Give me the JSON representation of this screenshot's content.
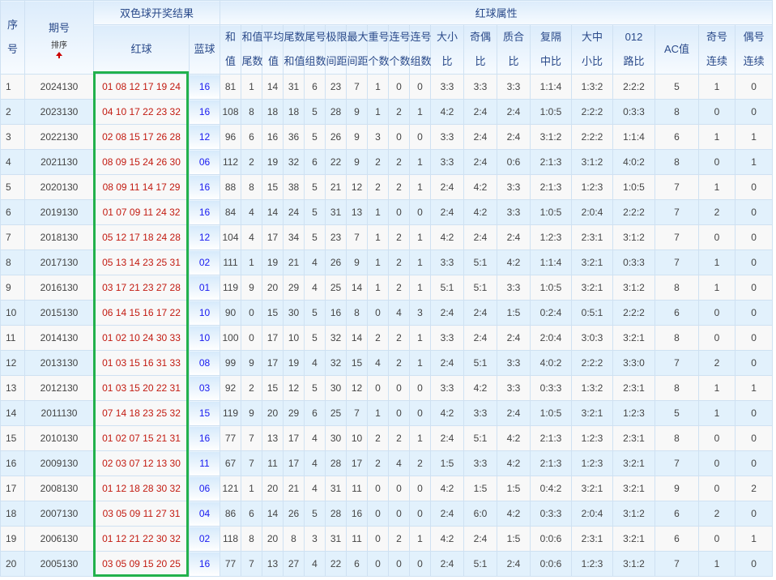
{
  "header": {
    "seq": "序号",
    "issue": "期号",
    "sort": "排序",
    "draw_result": "双色球开奖结果",
    "red_attrs": "红球属性",
    "red_ball": "红球",
    "blue_ball": "蓝球",
    "attrs": [
      "和值",
      "和值尾数",
      "平均值",
      "尾数和值",
      "尾号组数",
      "极限间距",
      "最大间距",
      "重号个数",
      "连号个数",
      "连号组数",
      "大小比",
      "奇偶比",
      "质合比",
      "复隔中比",
      "大中小比",
      "012路比",
      "AC值",
      "奇号连续",
      "偶号连续"
    ]
  },
  "colors": {
    "red_ball": "#c21a10",
    "blue_ball": "#1a1af0",
    "highlight_box": "#22b14c"
  },
  "rows": [
    {
      "seq": "1",
      "issue": "2024130",
      "red": "01 08 12 17 19 24",
      "blue": "16",
      "attrs": [
        "81",
        "1",
        "14",
        "31",
        "6",
        "23",
        "7",
        "1",
        "0",
        "0",
        "3:3",
        "3:3",
        "3:3",
        "1:1:4",
        "1:3:2",
        "2:2:2",
        "5",
        "1",
        "0"
      ]
    },
    {
      "seq": "2",
      "issue": "2023130",
      "red": "04 10 17 22 23 32",
      "blue": "16",
      "attrs": [
        "108",
        "8",
        "18",
        "18",
        "5",
        "28",
        "9",
        "1",
        "2",
        "1",
        "4:2",
        "2:4",
        "2:4",
        "1:0:5",
        "2:2:2",
        "0:3:3",
        "8",
        "0",
        "0"
      ]
    },
    {
      "seq": "3",
      "issue": "2022130",
      "red": "02 08 15 17 26 28",
      "blue": "12",
      "attrs": [
        "96",
        "6",
        "16",
        "36",
        "5",
        "26",
        "9",
        "3",
        "0",
        "0",
        "3:3",
        "2:4",
        "2:4",
        "3:1:2",
        "2:2:2",
        "1:1:4",
        "6",
        "1",
        "1"
      ]
    },
    {
      "seq": "4",
      "issue": "2021130",
      "red": "08 09 15 24 26 30",
      "blue": "06",
      "attrs": [
        "112",
        "2",
        "19",
        "32",
        "6",
        "22",
        "9",
        "2",
        "2",
        "1",
        "3:3",
        "2:4",
        "0:6",
        "2:1:3",
        "3:1:2",
        "4:0:2",
        "8",
        "0",
        "1"
      ]
    },
    {
      "seq": "5",
      "issue": "2020130",
      "red": "08 09 11 14 17 29",
      "blue": "16",
      "attrs": [
        "88",
        "8",
        "15",
        "38",
        "5",
        "21",
        "12",
        "2",
        "2",
        "1",
        "2:4",
        "4:2",
        "3:3",
        "2:1:3",
        "1:2:3",
        "1:0:5",
        "7",
        "1",
        "0"
      ]
    },
    {
      "seq": "6",
      "issue": "2019130",
      "red": "01 07 09 11 24 32",
      "blue": "16",
      "attrs": [
        "84",
        "4",
        "14",
        "24",
        "5",
        "31",
        "13",
        "1",
        "0",
        "0",
        "2:4",
        "4:2",
        "3:3",
        "1:0:5",
        "2:0:4",
        "2:2:2",
        "7",
        "2",
        "0"
      ]
    },
    {
      "seq": "7",
      "issue": "2018130",
      "red": "05 12 17 18 24 28",
      "blue": "12",
      "attrs": [
        "104",
        "4",
        "17",
        "34",
        "5",
        "23",
        "7",
        "1",
        "2",
        "1",
        "4:2",
        "2:4",
        "2:4",
        "1:2:3",
        "2:3:1",
        "3:1:2",
        "7",
        "0",
        "0"
      ]
    },
    {
      "seq": "8",
      "issue": "2017130",
      "red": "05 13 14 23 25 31",
      "blue": "02",
      "attrs": [
        "111",
        "1",
        "19",
        "21",
        "4",
        "26",
        "9",
        "1",
        "2",
        "1",
        "3:3",
        "5:1",
        "4:2",
        "1:1:4",
        "3:2:1",
        "0:3:3",
        "7",
        "1",
        "0"
      ]
    },
    {
      "seq": "9",
      "issue": "2016130",
      "red": "03 17 21 23 27 28",
      "blue": "01",
      "attrs": [
        "119",
        "9",
        "20",
        "29",
        "4",
        "25",
        "14",
        "1",
        "2",
        "1",
        "5:1",
        "5:1",
        "3:3",
        "1:0:5",
        "3:2:1",
        "3:1:2",
        "8",
        "1",
        "0"
      ]
    },
    {
      "seq": "10",
      "issue": "2015130",
      "red": "06 14 15 16 17 22",
      "blue": "10",
      "attrs": [
        "90",
        "0",
        "15",
        "30",
        "5",
        "16",
        "8",
        "0",
        "4",
        "3",
        "2:4",
        "2:4",
        "1:5",
        "0:2:4",
        "0:5:1",
        "2:2:2",
        "6",
        "0",
        "0"
      ]
    },
    {
      "seq": "11",
      "issue": "2014130",
      "red": "01 02 10 24 30 33",
      "blue": "10",
      "attrs": [
        "100",
        "0",
        "17",
        "10",
        "5",
        "32",
        "14",
        "2",
        "2",
        "1",
        "3:3",
        "2:4",
        "2:4",
        "2:0:4",
        "3:0:3",
        "3:2:1",
        "8",
        "0",
        "0"
      ]
    },
    {
      "seq": "12",
      "issue": "2013130",
      "red": "01 03 15 16 31 33",
      "blue": "08",
      "attrs": [
        "99",
        "9",
        "17",
        "19",
        "4",
        "32",
        "15",
        "4",
        "2",
        "1",
        "2:4",
        "5:1",
        "3:3",
        "4:0:2",
        "2:2:2",
        "3:3:0",
        "7",
        "2",
        "0"
      ]
    },
    {
      "seq": "13",
      "issue": "2012130",
      "red": "01 03 15 20 22 31",
      "blue": "03",
      "attrs": [
        "92",
        "2",
        "15",
        "12",
        "5",
        "30",
        "12",
        "0",
        "0",
        "0",
        "3:3",
        "4:2",
        "3:3",
        "0:3:3",
        "1:3:2",
        "2:3:1",
        "8",
        "1",
        "1"
      ]
    },
    {
      "seq": "14",
      "issue": "2011130",
      "red": "07 14 18 23 25 32",
      "blue": "15",
      "attrs": [
        "119",
        "9",
        "20",
        "29",
        "6",
        "25",
        "7",
        "1",
        "0",
        "0",
        "4:2",
        "3:3",
        "2:4",
        "1:0:5",
        "3:2:1",
        "1:2:3",
        "5",
        "1",
        "0"
      ]
    },
    {
      "seq": "15",
      "issue": "2010130",
      "red": "01 02 07 15 21 31",
      "blue": "16",
      "attrs": [
        "77",
        "7",
        "13",
        "17",
        "4",
        "30",
        "10",
        "2",
        "2",
        "1",
        "2:4",
        "5:1",
        "4:2",
        "2:1:3",
        "1:2:3",
        "2:3:1",
        "8",
        "0",
        "0"
      ]
    },
    {
      "seq": "16",
      "issue": "2009130",
      "red": "02 03 07 12 13 30",
      "blue": "11",
      "attrs": [
        "67",
        "7",
        "11",
        "17",
        "4",
        "28",
        "17",
        "2",
        "4",
        "2",
        "1:5",
        "3:3",
        "4:2",
        "2:1:3",
        "1:2:3",
        "3:2:1",
        "7",
        "0",
        "0"
      ]
    },
    {
      "seq": "17",
      "issue": "2008130",
      "red": "01 12 18 28 30 32",
      "blue": "06",
      "attrs": [
        "121",
        "1",
        "20",
        "21",
        "4",
        "31",
        "11",
        "0",
        "0",
        "0",
        "4:2",
        "1:5",
        "1:5",
        "0:4:2",
        "3:2:1",
        "3:2:1",
        "9",
        "0",
        "2"
      ]
    },
    {
      "seq": "18",
      "issue": "2007130",
      "red": "03 05 09 11 27 31",
      "blue": "04",
      "attrs": [
        "86",
        "6",
        "14",
        "26",
        "5",
        "28",
        "16",
        "0",
        "0",
        "0",
        "2:4",
        "6:0",
        "4:2",
        "0:3:3",
        "2:0:4",
        "3:1:2",
        "6",
        "2",
        "0"
      ]
    },
    {
      "seq": "19",
      "issue": "2006130",
      "red": "01 12 21 22 30 32",
      "blue": "02",
      "attrs": [
        "118",
        "8",
        "20",
        "8",
        "3",
        "31",
        "11",
        "0",
        "2",
        "1",
        "4:2",
        "2:4",
        "1:5",
        "0:0:6",
        "2:3:1",
        "3:2:1",
        "6",
        "0",
        "1"
      ]
    },
    {
      "seq": "20",
      "issue": "2005130",
      "red": "03 05 09 15 20 25",
      "blue": "16",
      "attrs": [
        "77",
        "7",
        "13",
        "27",
        "4",
        "22",
        "6",
        "0",
        "0",
        "0",
        "2:4",
        "5:1",
        "2:4",
        "0:0:6",
        "1:2:3",
        "3:1:2",
        "7",
        "1",
        "0"
      ]
    }
  ]
}
